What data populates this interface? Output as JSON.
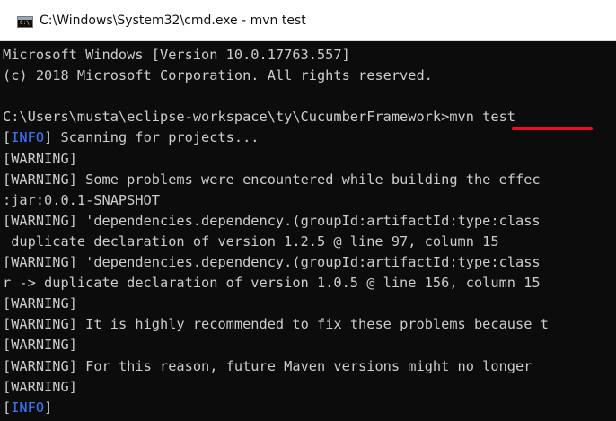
{
  "window": {
    "title": "C:\\Windows\\System32\\cmd.exe - mvn  test",
    "icon": "cmd-icon",
    "icon_glyph": "C:\\."
  },
  "console": {
    "lines": [
      {
        "text": "Microsoft Windows [Version 10.0.17763.557]"
      },
      {
        "text": "(c) 2018 Microsoft Corporation. All rights reserved."
      },
      {
        "text": ""
      },
      {
        "prompt": "C:\\Users\\musta\\eclipse-workspace\\ty\\CucumberFramework>",
        "command": "mvn test"
      },
      {
        "tag": "INFO",
        "text": " Scanning for projects..."
      },
      {
        "tag": "WARNING",
        "text": ""
      },
      {
        "tag": "WARNING",
        "text": " Some problems were encountered while building the effec"
      },
      {
        "text": ":jar:0.0.1-SNAPSHOT"
      },
      {
        "tag": "WARNING",
        "text": " 'dependencies.dependency.(groupId:artifactId:type:class"
      },
      {
        "text": " duplicate declaration of version 1.2.5 @ line 97, column 15"
      },
      {
        "tag": "WARNING",
        "text": " 'dependencies.dependency.(groupId:artifactId:type:class"
      },
      {
        "text": "r -> duplicate declaration of version 1.0.5 @ line 156, column 15"
      },
      {
        "tag": "WARNING",
        "text": ""
      },
      {
        "tag": "WARNING",
        "text": " It is highly recommended to fix these problems because t"
      },
      {
        "tag": "WARNING",
        "text": ""
      },
      {
        "tag": "WARNING",
        "text": " For this reason, future Maven versions might no longer"
      },
      {
        "tag": "WARNING",
        "text": ""
      },
      {
        "tag": "INFO",
        "text": ""
      }
    ]
  },
  "colors": {
    "background": "#0c0c0c",
    "foreground": "#cccccc",
    "info_tag": "#3b78ff",
    "annotation": "#e81123"
  }
}
